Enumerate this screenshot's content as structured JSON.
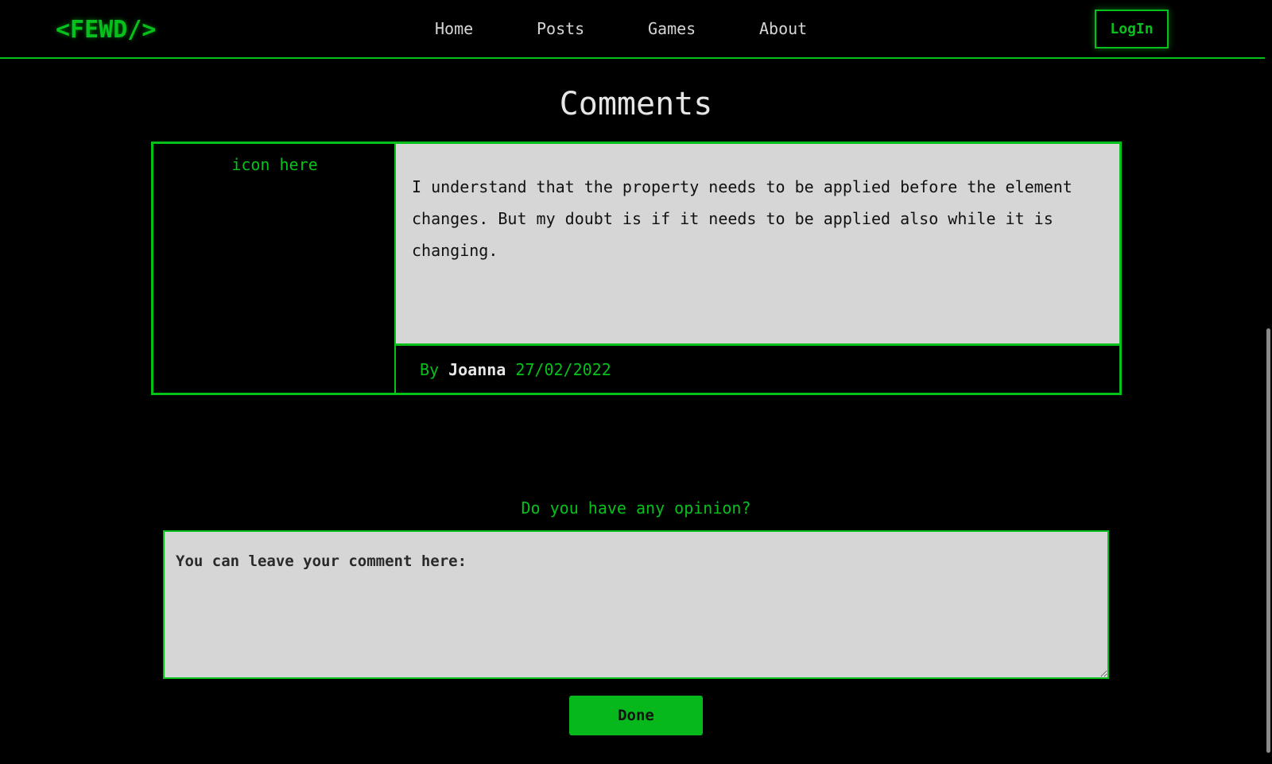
{
  "header": {
    "logo": "<FEWD/>",
    "nav": [
      "Home",
      "Posts",
      "Games",
      "About"
    ],
    "login_label": "LogIn"
  },
  "page": {
    "title": "Comments"
  },
  "comment": {
    "icon_placeholder": "icon here",
    "text": "I understand that the property needs to be applied before the element changes. But my doubt is if it needs to be applied also while it is changing.",
    "by_label": "By",
    "author": "Joanna",
    "date": "27/02/2022"
  },
  "form": {
    "prompt": "Do you have any opinion?",
    "placeholder": "You can leave your comment here:",
    "submit_label": "Done"
  },
  "colors": {
    "accent": "#06c01c",
    "background": "#000000",
    "panel": "#d6d6d6"
  }
}
